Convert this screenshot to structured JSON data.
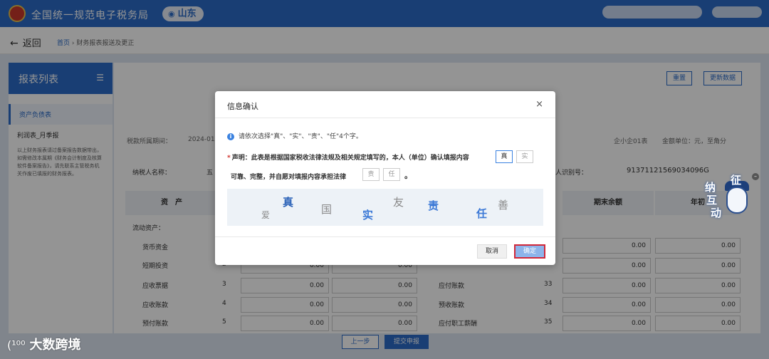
{
  "header": {
    "site_title": "全国统一规范电子税务局",
    "region": "山东"
  },
  "breadcrumb": {
    "back_label": "返回",
    "home": "首页",
    "separator": "›",
    "current": "财务报表报送及更正"
  },
  "sidebar": {
    "title": "报表列表",
    "items": [
      {
        "label": "资产负债表"
      },
      {
        "label": "利润表_月季报"
      }
    ],
    "note": "以上财务报表请过备案报告数据带出，如需修改本属期《财务会计制度及核算软件备案报告》，请先联系主管税务机关作废已填报的财务报表。"
  },
  "content": {
    "buttons": {
      "reset": "重置",
      "refresh": "更新数据"
    },
    "period_label": "税款所属期间：",
    "period_value": "2024-01",
    "form_type": "企小企01表",
    "unit": "金额单位：元，至角分",
    "taxpayer_label": "纳税人名称：",
    "taxpayer_value": "五",
    "id_label": "人识别号：",
    "id_value": "91371121569034096G",
    "col_asset": "资　产",
    "col_end": "期末余额",
    "col_begin": "年初",
    "row_header": "流动资产：",
    "rows_left": [
      "货币资金",
      "短期投资",
      "应收票据",
      "应收账款",
      "预付账款"
    ],
    "row_nums_left": [
      "",
      "2",
      "3",
      "4",
      "5"
    ],
    "rows_right": [
      "",
      "",
      "应付账款",
      "预收账款",
      "应付职工薪酬"
    ],
    "row_nums_right": [
      "",
      "",
      "33",
      "34",
      "35"
    ],
    "zero": "0.00",
    "prev_btn": "上一步",
    "submit_btn": "提交申报"
  },
  "modal": {
    "title": "信息确认",
    "close_icon": "×",
    "hint": "请依次选择\"真\"、\"实\"、\"责\"、\"任\"4个字。",
    "required_mark": "*",
    "decl_part1": "声明：此表是根据国家税收法律法规及相关规定填写的，本人（单位）确认填报内容",
    "decl_part2": "可靠、完整，并自愿对填报内容承担法律",
    "box_zhen": "真",
    "box_shi": "实",
    "box_ze": "责",
    "box_ren": "任",
    "period": "。",
    "captcha_chars": [
      "爱",
      "真",
      "国",
      "实",
      "友",
      "责",
      "任",
      "善"
    ],
    "cancel": "取消",
    "ok": "确定"
  },
  "mascot": {
    "chars": [
      "征",
      "纳",
      "互",
      "动"
    ]
  },
  "watermark": {
    "logo": "(¹⁰⁰",
    "text": "大数跨境"
  }
}
